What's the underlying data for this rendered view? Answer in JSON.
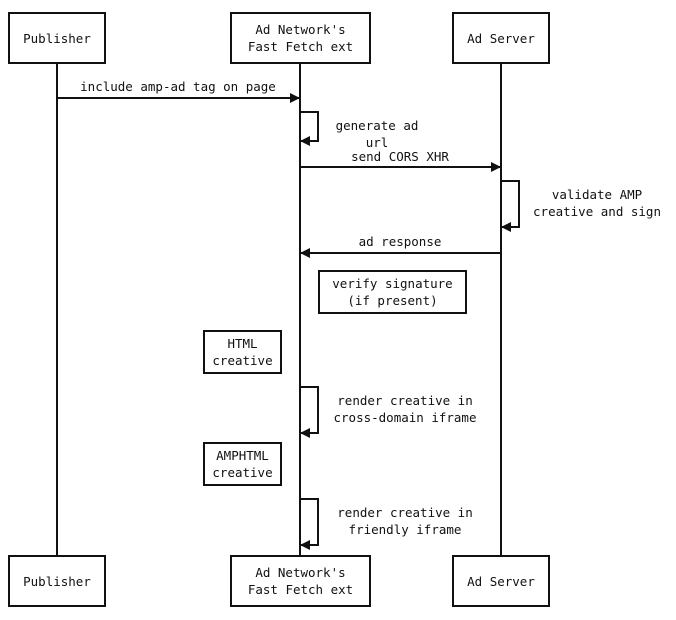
{
  "diagram": {
    "type": "sequence",
    "participants": [
      {
        "id": "publisher",
        "label": "Publisher"
      },
      {
        "id": "adnetwork",
        "label": "Ad Network's\nFast Fetch ext"
      },
      {
        "id": "adserver",
        "label": "Ad Server"
      }
    ],
    "messages": [
      {
        "from": "publisher",
        "to": "adnetwork",
        "label": "include amp-ad tag on page"
      },
      {
        "from": "adnetwork",
        "to": "adnetwork",
        "label": "generate ad url"
      },
      {
        "from": "adnetwork",
        "to": "adserver",
        "label": "send CORS XHR"
      },
      {
        "from": "adserver",
        "to": "adserver",
        "label": "validate AMP\ncreative and sign"
      },
      {
        "from": "adserver",
        "to": "adnetwork",
        "label": "ad response"
      },
      {
        "from": "adnetwork",
        "to": "adnetwork",
        "label": "render creative in\ncross-domain iframe"
      },
      {
        "from": "adnetwork",
        "to": "adnetwork",
        "label": "render creative in\nfriendly iframe"
      }
    ],
    "notes": [
      {
        "label": "verify signature\n(if present)"
      },
      {
        "label": "HTML\ncreative"
      },
      {
        "label": "AMPHTML\ncreative"
      }
    ]
  }
}
